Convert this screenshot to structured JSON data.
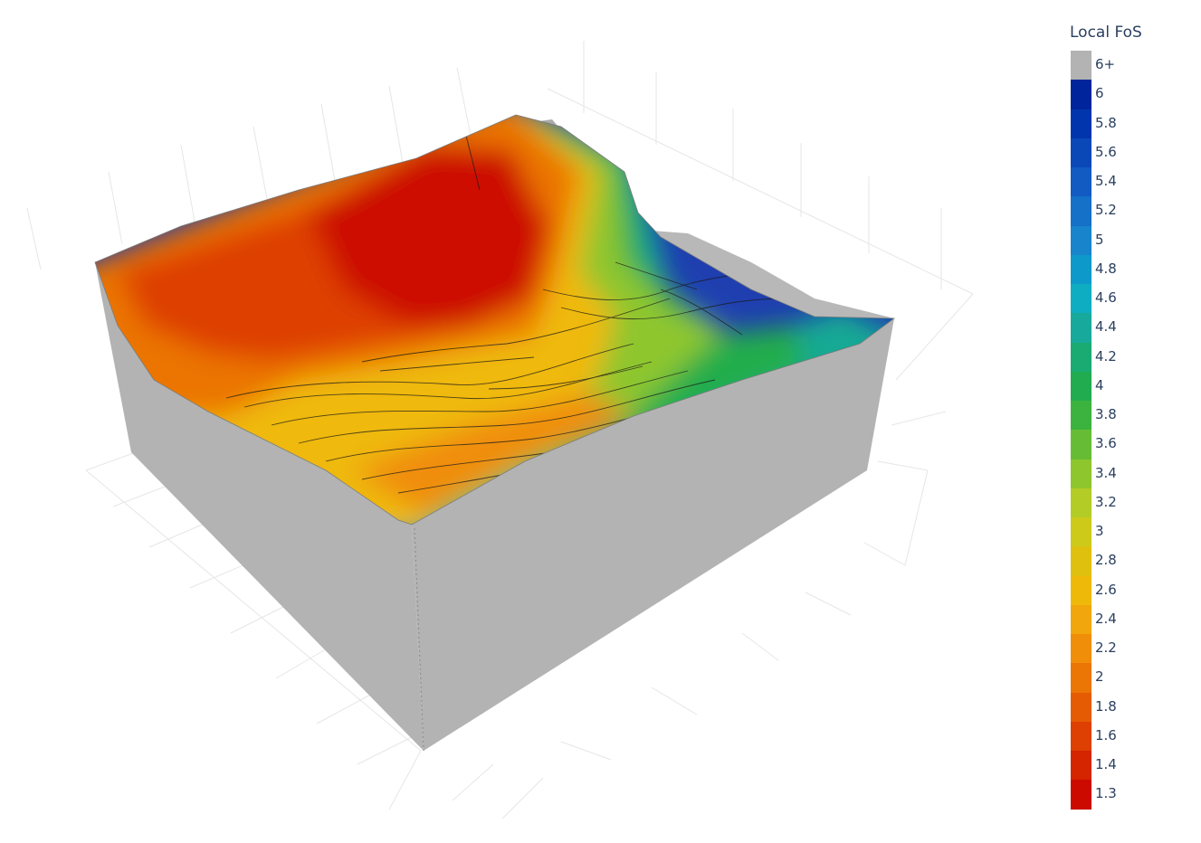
{
  "chart_data": {
    "type": "3d-surface",
    "legend": {
      "title": "Local FoS",
      "placement": "right",
      "items": [
        {
          "label": "6+",
          "color": "#b3b3b3"
        },
        {
          "label": "6",
          "color": "#00249b"
        },
        {
          "label": "5.8",
          "color": "#0035ad"
        },
        {
          "label": "5.6",
          "color": "#0a48b8"
        },
        {
          "label": "5.4",
          "color": "#115bc2"
        },
        {
          "label": "5.2",
          "color": "#1570c8"
        },
        {
          "label": "5",
          "color": "#1784cc"
        },
        {
          "label": "4.8",
          "color": "#0d99c9"
        },
        {
          "label": "4.6",
          "color": "#0eadc2"
        },
        {
          "label": "4.4",
          "color": "#17aa9c"
        },
        {
          "label": "4.2",
          "color": "#1aab73"
        },
        {
          "label": "4",
          "color": "#20ac4f"
        },
        {
          "label": "3.8",
          "color": "#3cb33e"
        },
        {
          "label": "3.6",
          "color": "#66bd35"
        },
        {
          "label": "3.4",
          "color": "#8ec62e"
        },
        {
          "label": "3.2",
          "color": "#b4cc26"
        },
        {
          "label": "3",
          "color": "#cdca1a"
        },
        {
          "label": "2.8",
          "color": "#dfc00e"
        },
        {
          "label": "2.6",
          "color": "#efb90a"
        },
        {
          "label": "2.4",
          "color": "#f2a60d"
        },
        {
          "label": "2.2",
          "color": "#f08d09"
        },
        {
          "label": "2",
          "color": "#eb7505"
        },
        {
          "label": "1.8",
          "color": "#e55b04"
        },
        {
          "label": "1.6",
          "color": "#de3f02"
        },
        {
          "label": "1.4",
          "color": "#d52400"
        },
        {
          "label": "1.3",
          "color": "#cc0a00"
        }
      ]
    },
    "body_color": "#b3b3b3",
    "grid": true
  }
}
